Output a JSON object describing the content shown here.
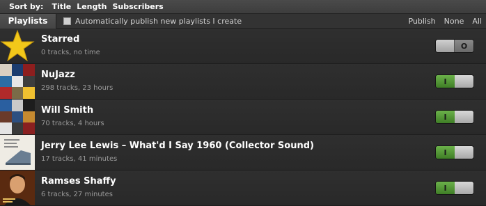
{
  "sort_bar": {
    "label": "Sort by:",
    "options": [
      "Title",
      "Length",
      "Subscribers"
    ]
  },
  "header": {
    "tab": "Playlists",
    "auto_publish_label": "Automatically publish new playlists I create",
    "auto_publish_checked": false,
    "bulk": [
      "Publish",
      "None",
      "All"
    ]
  },
  "playlists": [
    {
      "title": "Starred",
      "subtitle": "0 tracks, no time",
      "published": false,
      "thumb": "star-icon"
    },
    {
      "title": "NuJazz",
      "subtitle": "298 tracks, 23 hours",
      "published": true,
      "thumb": "album-collage"
    },
    {
      "title": "Will Smith",
      "subtitle": "70 tracks, 4 hours",
      "published": true,
      "thumb": "album-collage"
    },
    {
      "title": "Jerry Lee Lewis – What'd I Say 1960 (Collector Sound)",
      "subtitle": "17 tracks, 41 minutes",
      "published": true,
      "thumb": "album-cover-piano"
    },
    {
      "title": "Ramses Shaffy",
      "subtitle": "6 tracks, 27 minutes",
      "published": true,
      "thumb": "album-cover-portrait"
    }
  ],
  "toggle_labels": {
    "on": "I",
    "off": "O"
  },
  "colors": {
    "toggle_on": "#4f9433",
    "star": "#f2c81a"
  }
}
